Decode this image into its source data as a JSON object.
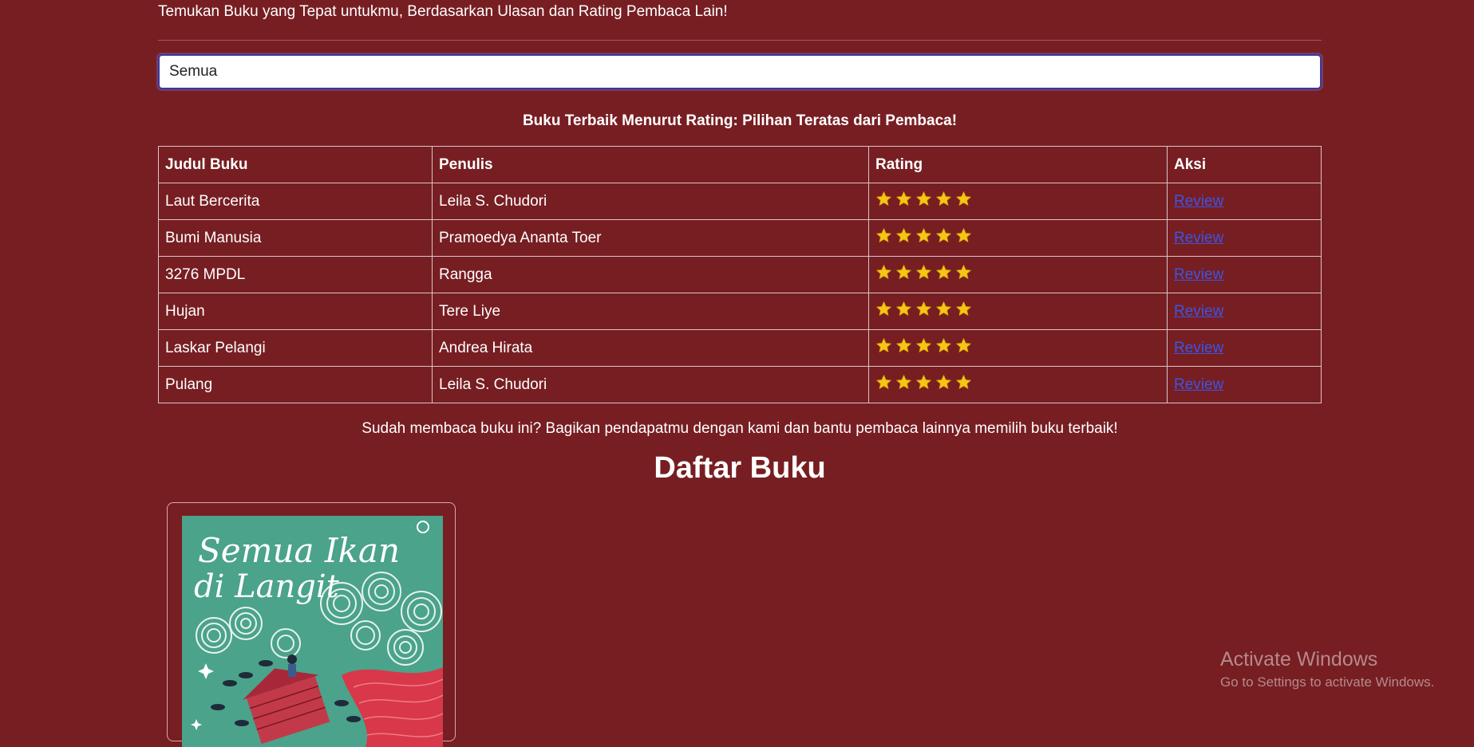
{
  "header": {
    "tagline": "Temukan Buku yang Tepat untukmu, Berdasarkan Ulasan dan Rating Pembaca Lain!"
  },
  "search": {
    "value": "Semua"
  },
  "top_rated": {
    "title": "Buku Terbaik Menurut Rating: Pilihan Teratas dari Pembaca!",
    "columns": [
      "Judul Buku",
      "Penulis",
      "Rating",
      "Aksi"
    ],
    "rows": [
      {
        "title": "Laut Bercerita",
        "author": "Leila S. Chudori",
        "rating": 5,
        "action": "Review"
      },
      {
        "title": "Bumi Manusia",
        "author": "Pramoedya Ananta Toer",
        "rating": 5,
        "action": "Review"
      },
      {
        "title": "3276 MPDL",
        "author": "Rangga",
        "rating": 5,
        "action": "Review"
      },
      {
        "title": "Hujan",
        "author": "Tere Liye",
        "rating": 5,
        "action": "Review"
      },
      {
        "title": "Laskar Pelangi",
        "author": "Andrea Hirata",
        "rating": 5,
        "action": "Review"
      },
      {
        "title": "Pulang",
        "author": "Leila S. Chudori",
        "rating": 5,
        "action": "Review"
      }
    ]
  },
  "cta": {
    "text": "Sudah membaca buku ini? Bagikan pendapatmu dengan kami dan bantu pembaca lainnya memilih buku terbaik!"
  },
  "book_list": {
    "title": "Daftar Buku",
    "cover_text_line1": "Semua Ikan",
    "cover_text_line2": "di Langit"
  },
  "watermark": {
    "title": "Activate Windows",
    "subtitle": "Go to Settings to activate Windows."
  },
  "colors": {
    "background": "#771e22",
    "star": "#f5c518",
    "link": "#3b55e6",
    "cover": "#4aa38a"
  }
}
